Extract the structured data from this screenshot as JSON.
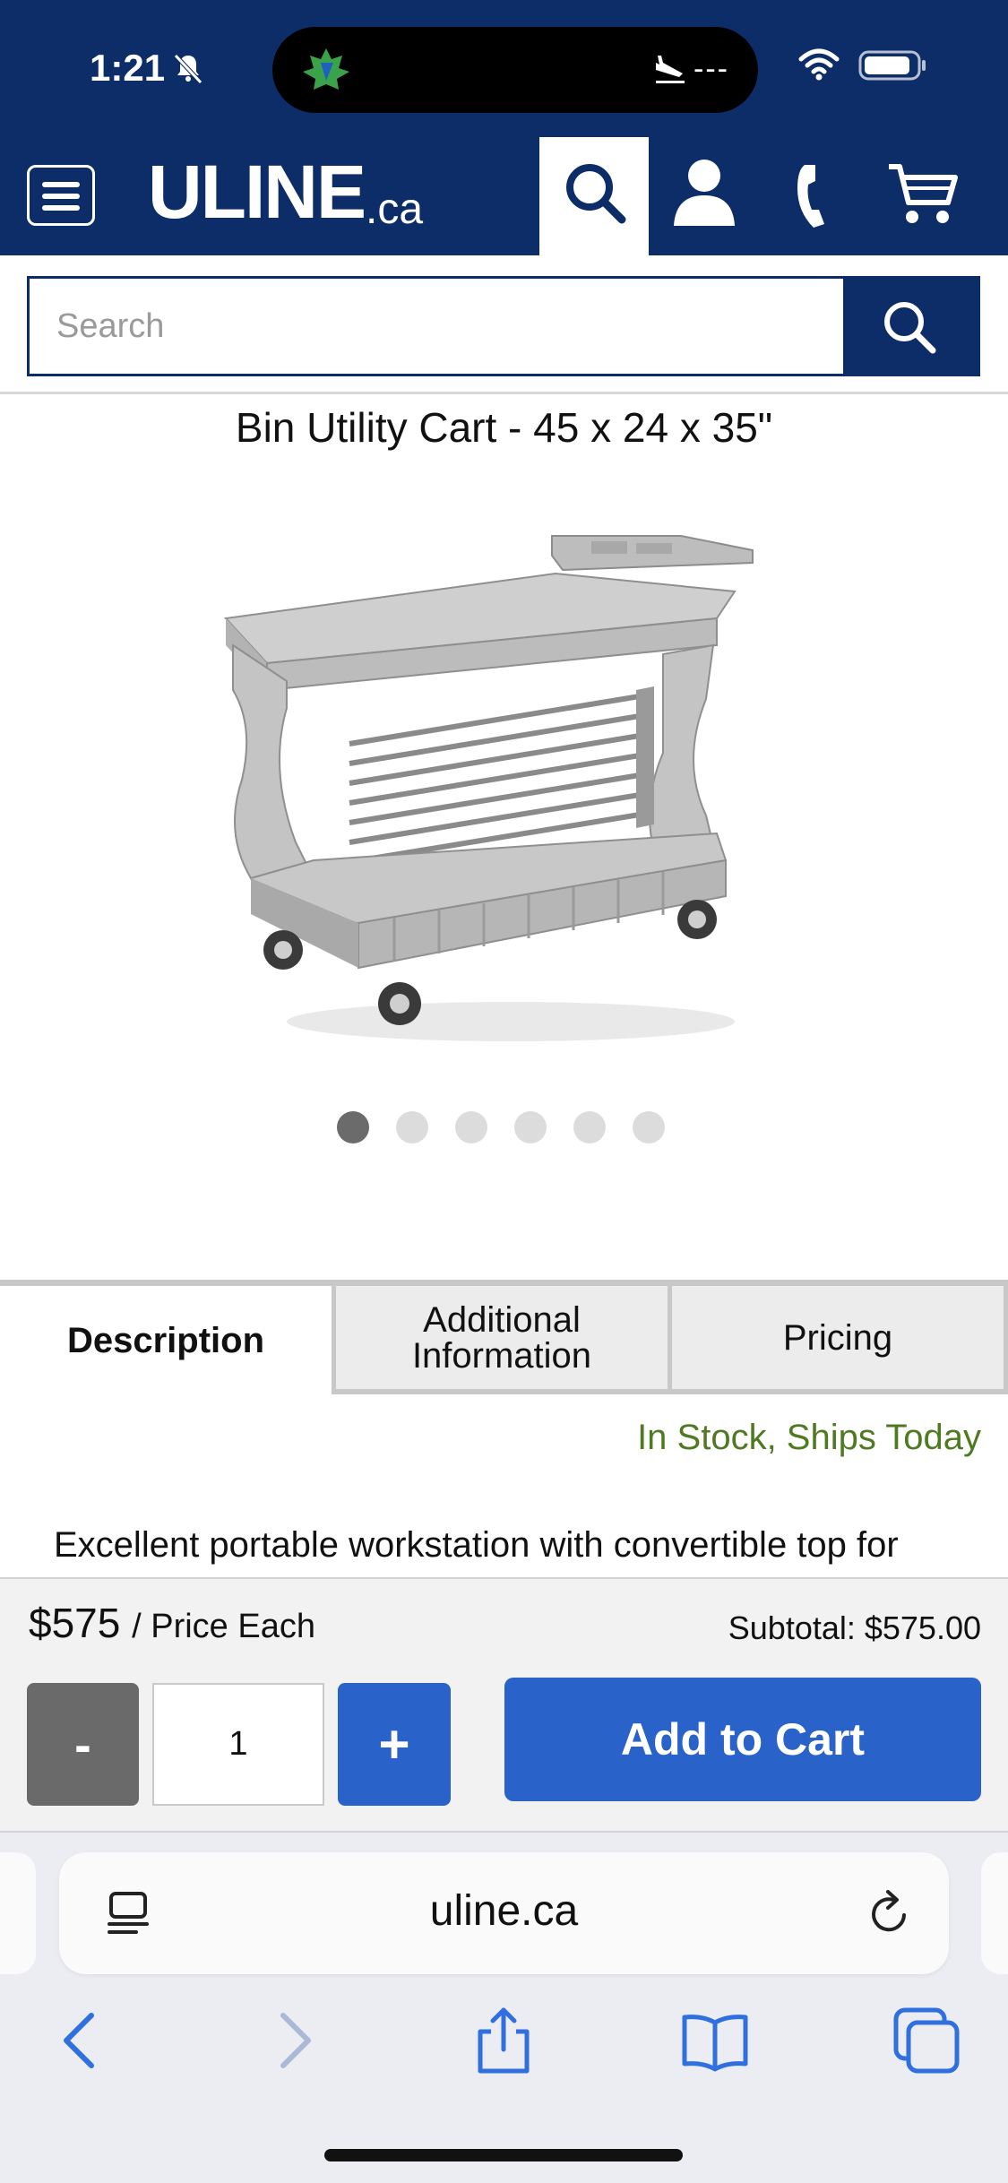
{
  "status_bar": {
    "time": "1:21",
    "flight_status": "---"
  },
  "header": {
    "logo_text": "ULINE",
    "logo_suffix": ".ca",
    "icons": [
      "menu-icon",
      "search-icon",
      "account-icon",
      "phone-icon",
      "cart-icon"
    ],
    "brand_color": "#0d2d68"
  },
  "search": {
    "placeholder": "Search"
  },
  "product": {
    "title": "Bin Utility Cart - 45 x 24 x 35\"",
    "image_count": 6,
    "active_image": 1
  },
  "tabs": {
    "description": "Description",
    "additional_line1": "Additional",
    "additional_line2": "Information",
    "pricing": "Pricing"
  },
  "stock_status": "In Stock, Ships Today",
  "description_text": "Excellent portable workstation with convertible top for organizing bins and more.",
  "purchase": {
    "price": "$575",
    "price_unit": "/ Price Each",
    "subtotal": "Subtotal: $575.00",
    "minus_label": "-",
    "quantity": "1",
    "plus_label": "+",
    "add_to_cart": "Add to Cart",
    "accent_color": "#2962c8"
  },
  "browser": {
    "url": "uline.ca"
  }
}
